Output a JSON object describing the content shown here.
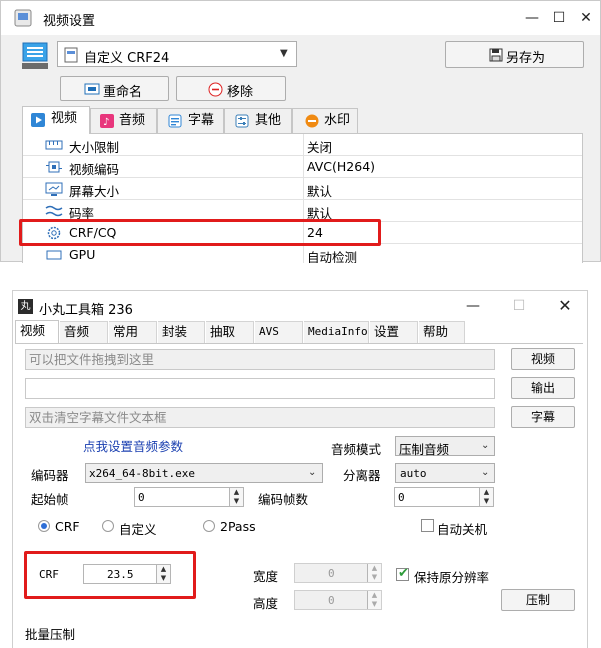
{
  "window1": {
    "title": "视频设置",
    "preset_value": "自定义 CRF24",
    "save_as_label": "另存为",
    "rename_label": "重命名",
    "remove_label": "移除",
    "tabs": [
      {
        "label": "视频",
        "icon": "play-circle-icon"
      },
      {
        "label": "音频",
        "icon": "music-note-icon"
      },
      {
        "label": "字幕",
        "icon": "subtitle-icon"
      },
      {
        "label": "其他",
        "icon": "sliders-icon"
      },
      {
        "label": "水印",
        "icon": "watermark-icon"
      }
    ],
    "properties": [
      {
        "label": "大小限制",
        "value": "关闭",
        "icon": "ruler-icon"
      },
      {
        "label": "视频编码",
        "value": "AVC(H264)",
        "icon": "chip-icon"
      },
      {
        "label": "屏幕大小",
        "value": "默认",
        "icon": "monitor-icon"
      },
      {
        "label": "码率",
        "value": "默认",
        "icon": "wave-icon"
      },
      {
        "label": "CRF/CQ",
        "value": "24",
        "icon": "gear-icon"
      },
      {
        "label": "GPU",
        "value": "自动检测",
        "icon": "gpu-icon"
      }
    ]
  },
  "window2": {
    "title": "小丸工具箱 236",
    "logo_text": "丸",
    "tabs": [
      "视频",
      "音频",
      "常用",
      "封装",
      "抽取",
      "AVS",
      "MediaInfo",
      "设置",
      "帮助"
    ],
    "video_input_placeholder": "可以把文件拖拽到这里",
    "video_button": "视频",
    "output_value": "",
    "output_button": "输出",
    "subtitle_placeholder": "双击清空字幕文件文本框",
    "subtitle_button": "字幕",
    "audio_params_link": "点我设置音频参数",
    "audio_mode_label": "音频模式",
    "audio_mode_value": "压制音频",
    "encoder_label": "编码器",
    "encoder_value": "x264_64-8bit.exe",
    "splitter_label": "分离器",
    "splitter_value": "auto",
    "start_frame_label": "起始帧",
    "start_frame_value": "0",
    "encode_frames_label": "编码帧数",
    "encode_frames_value": "0",
    "radio_crf": "CRF",
    "radio_custom": "自定义",
    "radio_2pass": "2Pass",
    "auto_shutdown_label": "自动关机",
    "crf_label": "CRF",
    "crf_value": "23.5",
    "width_label": "宽度",
    "width_value": "0",
    "height_label": "高度",
    "height_value": "0",
    "keep_res_label": "保持原分辨率",
    "encode_button": "压制",
    "batch_label": "批量压制"
  },
  "colors": {
    "highlight": "#e11b1b",
    "link": "#1a3fb0",
    "accent": "#2f6fd6"
  }
}
